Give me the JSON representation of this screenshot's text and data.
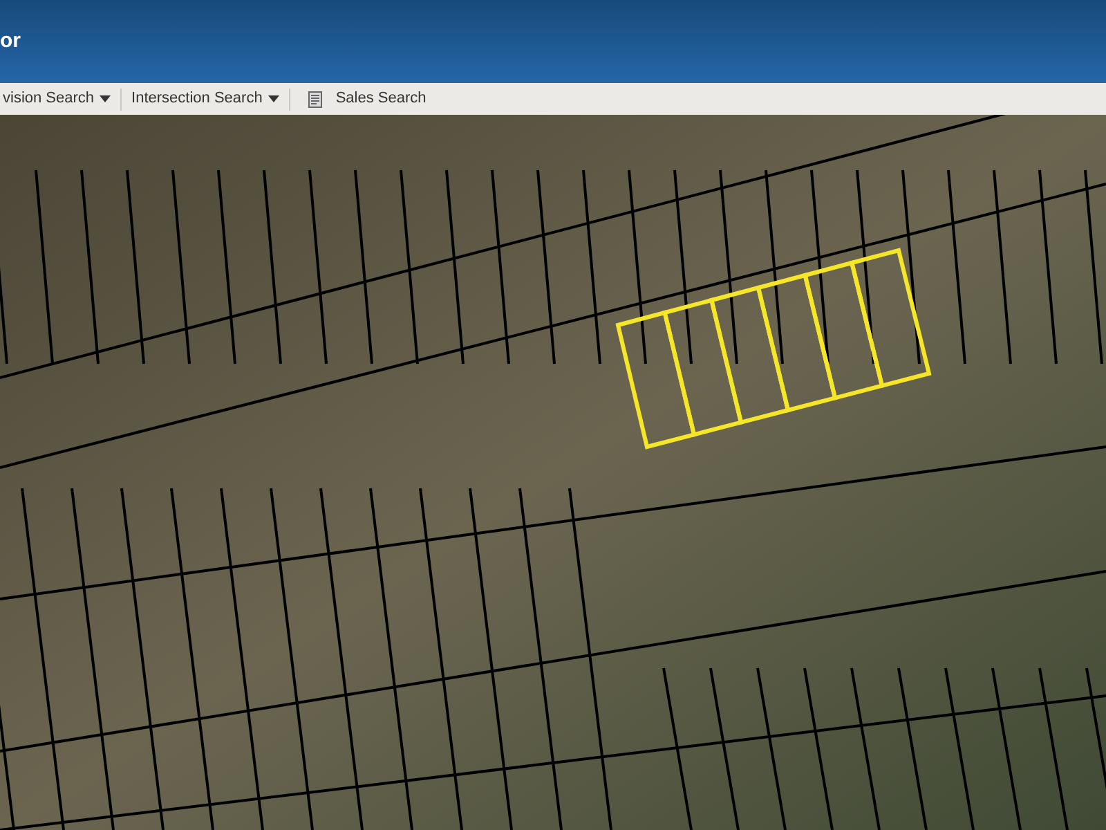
{
  "header": {
    "title": "or"
  },
  "toolbar": [
    {
      "label": "vision Search",
      "kind": "dropdown"
    },
    {
      "label": "Intersection Search",
      "kind": "dropdown"
    },
    {
      "label": "Sales Search",
      "kind": "document"
    }
  ]
}
